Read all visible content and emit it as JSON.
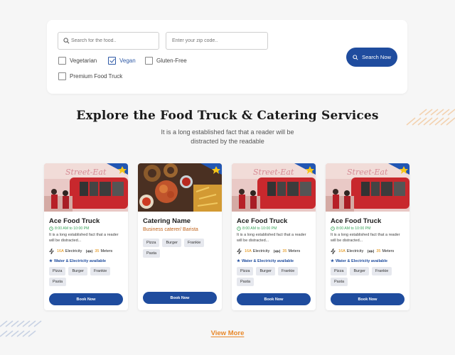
{
  "search": {
    "food_placeholder": "Search for the food..",
    "zip_placeholder": "Enter your zip code..",
    "button_label": "Search Now",
    "filters": [
      {
        "label": "Vegetarian",
        "checked": false
      },
      {
        "label": "Vegan",
        "checked": true
      },
      {
        "label": "Gluten-Free",
        "checked": false
      },
      {
        "label": "Premium Food Truck",
        "checked": false
      }
    ]
  },
  "section": {
    "title": "Explore the Food Truck & Catering Services",
    "subtitle": "It is a long established fact that a reader will be distracted by the readable"
  },
  "cards": [
    {
      "type": "truck",
      "title": "Ace Food Truck",
      "hours": "8:00 AM to 10:00 PM",
      "description": "It is a long established fact that a reader will be distracted...",
      "electricity_amp": "16A",
      "electricity_label": "Electricity",
      "distance_value": "35",
      "distance_label": "Meters",
      "availability": "Water & Electricity available",
      "tags": [
        "Pizza",
        "Burger",
        "Frankie",
        "Pasta"
      ],
      "button": "Book Now"
    },
    {
      "type": "catering",
      "title": "Catering Name",
      "subtitle": "Business caterer/ Barista",
      "tags": [
        "Pizza",
        "Burger",
        "Frankie",
        "Pasta"
      ],
      "button": "Book Now"
    },
    {
      "type": "truck",
      "title": "Ace Food Truck",
      "hours": "8:00 AM to 10:00 PM",
      "description": "It is a long established fact that a reader will be distracted...",
      "electricity_amp": "16A",
      "electricity_label": "Electricity",
      "distance_value": "35",
      "distance_label": "Meters",
      "availability": "Water & Electricity available",
      "tags": [
        "Pizza",
        "Burger",
        "Frankie",
        "Pasta"
      ],
      "button": "Book Now"
    },
    {
      "type": "truck",
      "title": "Ace Food Truck",
      "hours": "8:00 AM to 10:00 PM",
      "description": "It is a long established fact that a reader will be distracted...",
      "electricity_amp": "16A",
      "electricity_label": "Electricity",
      "distance_value": "35",
      "distance_label": "Meters",
      "availability": "Water & Electricity available",
      "tags": [
        "Pizza",
        "Burger",
        "Frankie",
        "Pasta"
      ],
      "button": "Book Now"
    }
  ],
  "view_more": "View More",
  "colors": {
    "primary": "#1f4c9e",
    "accent": "#e8882a",
    "hours_green": "#3aa35a",
    "background": "#f6f6f6"
  }
}
